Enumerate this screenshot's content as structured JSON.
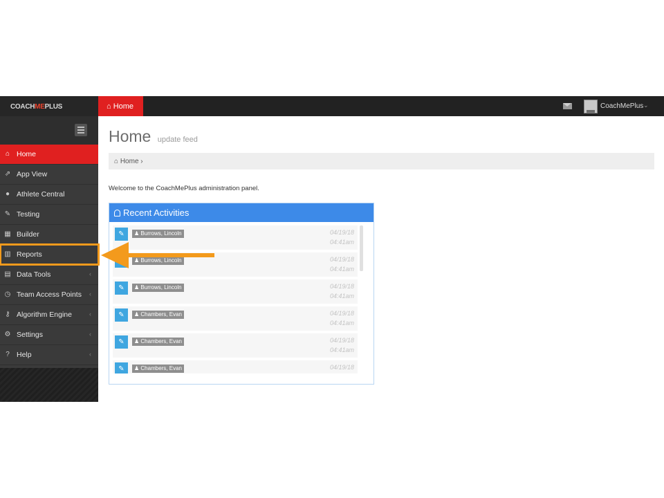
{
  "topbar": {
    "brand_pre": "COACH",
    "brand_mid": "ME",
    "brand_post": "PLUS",
    "tab_icon": "home-icon",
    "tab_label": "Home",
    "user_name": "CoachMePlus"
  },
  "sidebar": {
    "items": [
      {
        "label": "Home",
        "icon": "home-icon",
        "active": true
      },
      {
        "label": "App View",
        "icon": "external-link-icon"
      },
      {
        "label": "Athlete Central",
        "icon": "users-icon"
      },
      {
        "label": "Testing",
        "icon": "edit-icon"
      },
      {
        "label": "Builder",
        "icon": "calendar-icon"
      },
      {
        "label": "Reports",
        "icon": "bar-chart-icon"
      },
      {
        "label": "Data Tools",
        "icon": "table-icon"
      },
      {
        "label": "Team Access Points",
        "icon": "clock-icon"
      },
      {
        "label": "Algorithm Engine",
        "icon": "key-icon"
      },
      {
        "label": "Settings",
        "icon": "gears-icon"
      },
      {
        "label": "Help",
        "icon": "question-icon"
      }
    ]
  },
  "main": {
    "title": "Home",
    "subtitle": "update feed",
    "breadcrumb_label": "Home",
    "breadcrumb_sep": "›",
    "welcome": "Welcome to the CoachMePlus administration panel.",
    "panel_title": "Recent Activities",
    "activities": [
      {
        "name": "Burrows, Lincoln",
        "date": "04/19/18",
        "time": "04:41am"
      },
      {
        "name": "Burrows, Lincoln",
        "date": "04/19/18",
        "time": "04:41am"
      },
      {
        "name": "Burrows, Lincoln",
        "date": "04/19/18",
        "time": "04:41am"
      },
      {
        "name": "Chambers, Evan",
        "date": "04/19/18",
        "time": "04:41am"
      },
      {
        "name": "Chambers, Evan",
        "date": "04/19/18",
        "time": "04:41am"
      },
      {
        "name": "Chambers, Evan",
        "date": "04/19/18",
        "time": ""
      }
    ]
  },
  "colors": {
    "accent": "#e02020",
    "highlight": "#f39a1c",
    "panel": "#3d8ae8"
  }
}
